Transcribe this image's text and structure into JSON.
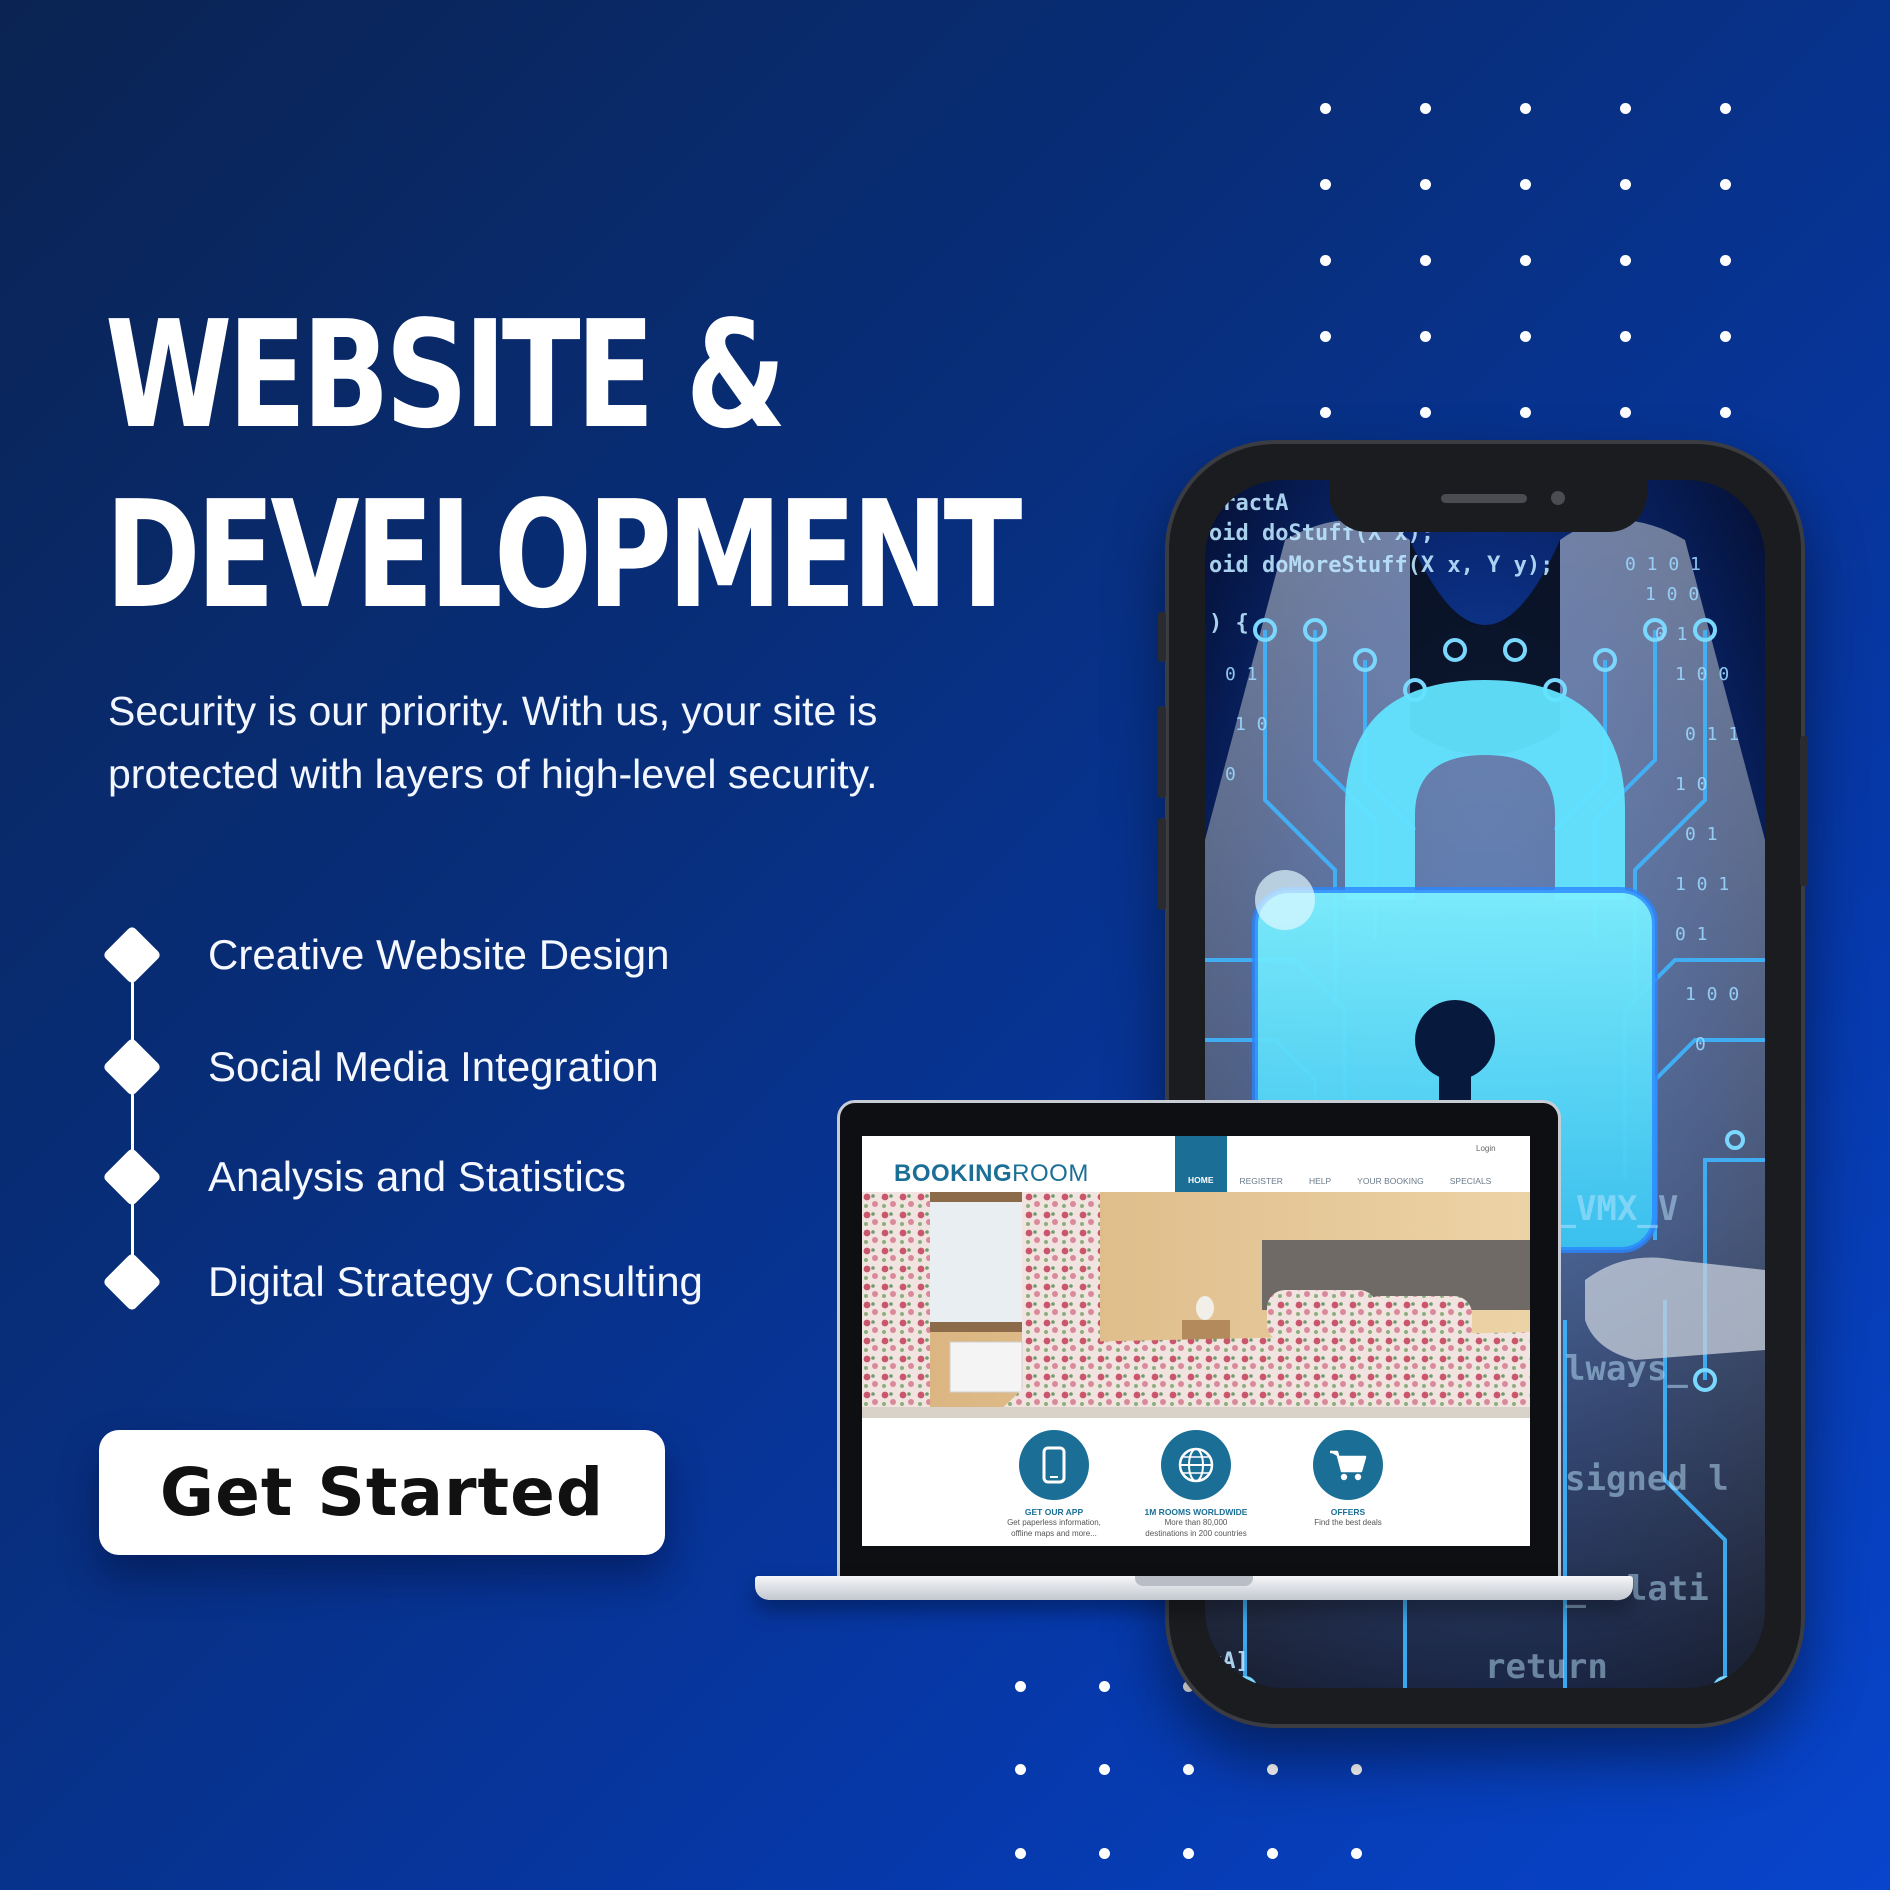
{
  "headline": {
    "line1": "WEBSITE &",
    "line2": "DEVELOPMENT"
  },
  "intro": "Security is our priority. With us, your site is protected with layers of high-level security.",
  "features": [
    {
      "label": "Creative Website Design"
    },
    {
      "label": "Social Media Integration"
    },
    {
      "label": "Analysis and Statistics"
    },
    {
      "label": "Digital Strategy Consulting"
    }
  ],
  "cta": {
    "label": "Get Started"
  },
  "phone_screen": {
    "code_lines": [
      "tractA",
      "oid doStuff(X x);",
      "oid doMoreStuff(X x, Y y);",
      ") {",
      "M_VMX_V",
      "lways_",
      "signed l",
      "m_volati",
      "xA]",
      "return"
    ]
  },
  "laptop_site": {
    "brand_bold": "BOOKING",
    "brand_light": "ROOM",
    "login": "Login",
    "nav": [
      "HOME",
      "REGISTER",
      "HELP",
      "YOUR BOOKING",
      "SPECIALS"
    ],
    "features": [
      {
        "title": "GET OUR APP",
        "desc1": "Get paperless information,",
        "desc2": "offline maps and more...",
        "icon": "smartphone-icon"
      },
      {
        "title": "1M ROOMS WORLDWIDE",
        "desc1": "More than 80,000",
        "desc2": "destinations in 200 countries",
        "icon": "globe-icon"
      },
      {
        "title": "OFFERS",
        "desc1": "Find the best deals",
        "desc2": "",
        "icon": "shopping-cart-icon"
      }
    ]
  },
  "colors": {
    "background_start": "#0a2352",
    "background_end": "#0845cc",
    "circuit_glow": "#5fe0ff",
    "site_accent": "#1b6f96"
  }
}
